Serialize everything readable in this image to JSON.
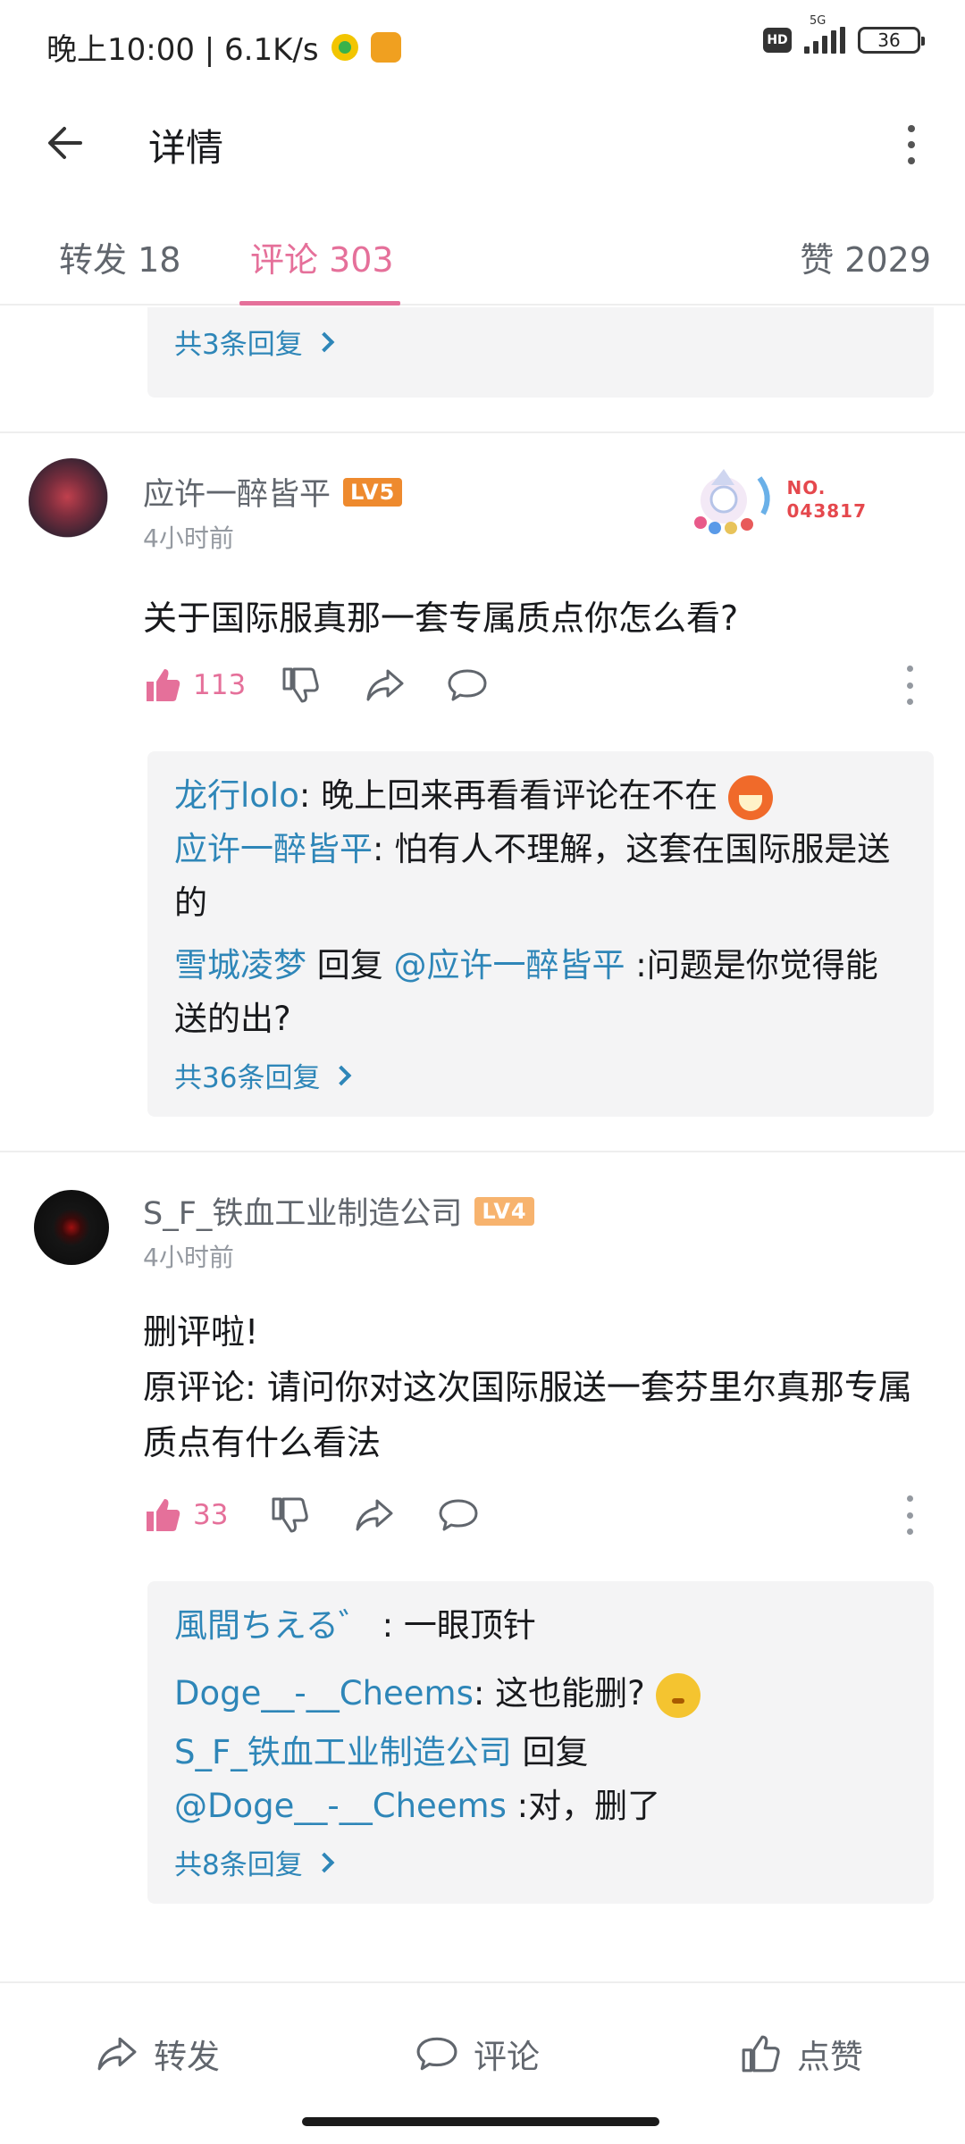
{
  "status_bar": {
    "time_speed": "晚上10:00 | 6.1K/s",
    "hd": "HD",
    "network": "5G",
    "battery": "36"
  },
  "header": {
    "title": "详情"
  },
  "tabs": [
    {
      "label": "转发 18"
    },
    {
      "label": "评论 303"
    },
    {
      "label": "赞 2029"
    }
  ],
  "prev_thread": {
    "more_label": "共3条回复"
  },
  "comments": [
    {
      "user": "应许一醉皆平",
      "level": "LV5",
      "time": "4小时前",
      "fan_badge": "NO.\n043817",
      "text": "关于国际服真那一套专属质点你怎么看?",
      "likes": "113",
      "replies": [
        {
          "user": "龙行lolo",
          "sep": ": ",
          "text": "晚上回来再看看评论在不在"
        },
        {
          "user": "应许一醉皆平",
          "sep": ": ",
          "text": "怕有人不理解，这套在国际服是送的"
        },
        {
          "user": "雪城凌梦",
          "reply_word": " 回复 ",
          "target": "@应许一醉皆平",
          "text": " :问题是你觉得能送的出?"
        }
      ],
      "more_label": "共36条回复"
    },
    {
      "user": "S_F_铁血工业制造公司",
      "level": "LV4",
      "time": "4小时前",
      "text_line1": "删评啦!",
      "text_line2": "原评论: 请问你对这次国际服送一套芬里尔真那专属质点有什么看法",
      "likes": "33",
      "replies": [
        {
          "user": "風間ちえる゛",
          "sep": " : ",
          "text": "一眼顶针"
        },
        {
          "user": "Doge__-__Cheems",
          "sep": ": ",
          "text": "这也能删?"
        },
        {
          "user": "S_F_铁血工业制造公司",
          "reply_word": " 回复 ",
          "target": "@Doge__-__Cheems",
          "text": " :对，删了"
        }
      ],
      "more_label": "共8条回复"
    }
  ],
  "bottom_bar": {
    "repost_label": "转发",
    "comment_label": "评论",
    "like_label": "点赞"
  },
  "colors": {
    "accent_pink": "#e5709a",
    "link_blue": "#2e86b8",
    "level5": "#ee8a2e",
    "level4": "#f7b36e"
  }
}
